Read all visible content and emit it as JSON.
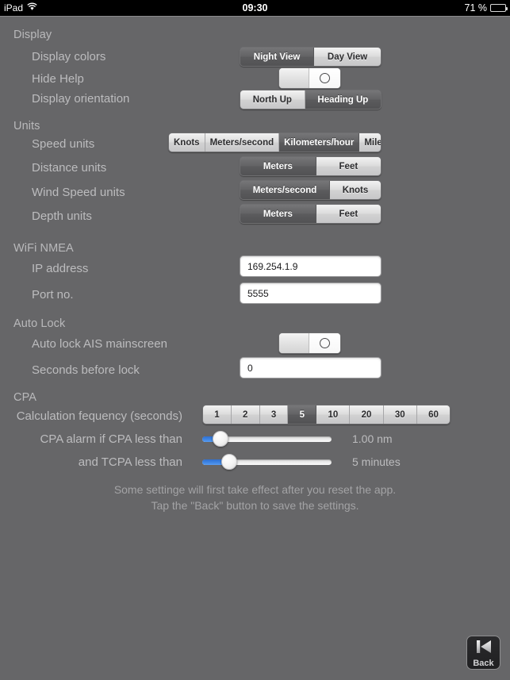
{
  "statusbar": {
    "device": "iPad",
    "wifi_icon": "wifi-icon",
    "time": "09:30",
    "battery_percent": "71 %",
    "battery_icon": "battery-icon",
    "battery_level": 71
  },
  "sections": {
    "display": {
      "title": "Display",
      "rows": {
        "display_colors": {
          "label": "Display colors",
          "options": [
            "Night View",
            "Day View"
          ],
          "selected": 0
        },
        "hide_help": {
          "label": "Hide Help",
          "state": "off"
        },
        "display_orientation": {
          "label": "Display orientation",
          "options": [
            "North Up",
            "Heading Up"
          ],
          "selected": 1
        }
      }
    },
    "units": {
      "title": "Units",
      "rows": {
        "speed_units": {
          "label": "Speed units",
          "options": [
            "Knots",
            "Meters/second",
            "Kilometers/hour",
            "Miles/hour"
          ],
          "selected": 2
        },
        "distance_units": {
          "label": "Distance units",
          "options": [
            "Meters",
            "Feet"
          ],
          "selected": 0
        },
        "wind_speed_units": {
          "label": "Wind Speed units",
          "options": [
            "Meters/second",
            "Knots"
          ],
          "selected": 0
        },
        "depth_units": {
          "label": "Depth units",
          "options": [
            "Meters",
            "Feet"
          ],
          "selected": 0
        }
      }
    },
    "wifi_nmea": {
      "title": "WiFi NMEA",
      "rows": {
        "ip_address": {
          "label": "IP address",
          "value": "169.254.1.9"
        },
        "port_no": {
          "label": "Port no.",
          "value": "5555"
        }
      }
    },
    "auto_lock": {
      "title": "Auto Lock",
      "rows": {
        "auto_lock_ais": {
          "label": "Auto lock AIS mainscreen",
          "state": "off"
        },
        "seconds_before_lock": {
          "label": "Seconds before lock",
          "value": "0"
        }
      }
    },
    "cpa": {
      "title": "CPA",
      "rows": {
        "calculation_frequency": {
          "label": "Calculation fequency (seconds)",
          "options": [
            "1",
            "2",
            "3",
            "5",
            "10",
            "20",
            "30",
            "60"
          ],
          "selected": 3
        },
        "cpa_alarm": {
          "label": "CPA alarm if CPA less than",
          "value_text": "1.00 nm",
          "percent": 14
        },
        "tcpa_alarm": {
          "label": "and TCPA less than",
          "value_text": "5 minutes",
          "percent": 21
        }
      }
    }
  },
  "note": {
    "line1": "Some settinge will first take effect after you reset the app.",
    "line2": "Tap the \"Back\" button to save the settings."
  },
  "back_button": {
    "label": "Back",
    "icon": "skip-back-icon"
  },
  "colors": {
    "background": "#666668",
    "accent_slider": "#3f86e4",
    "label_text": "#bcbcbe",
    "selected_segment": "#5b5b5d"
  }
}
